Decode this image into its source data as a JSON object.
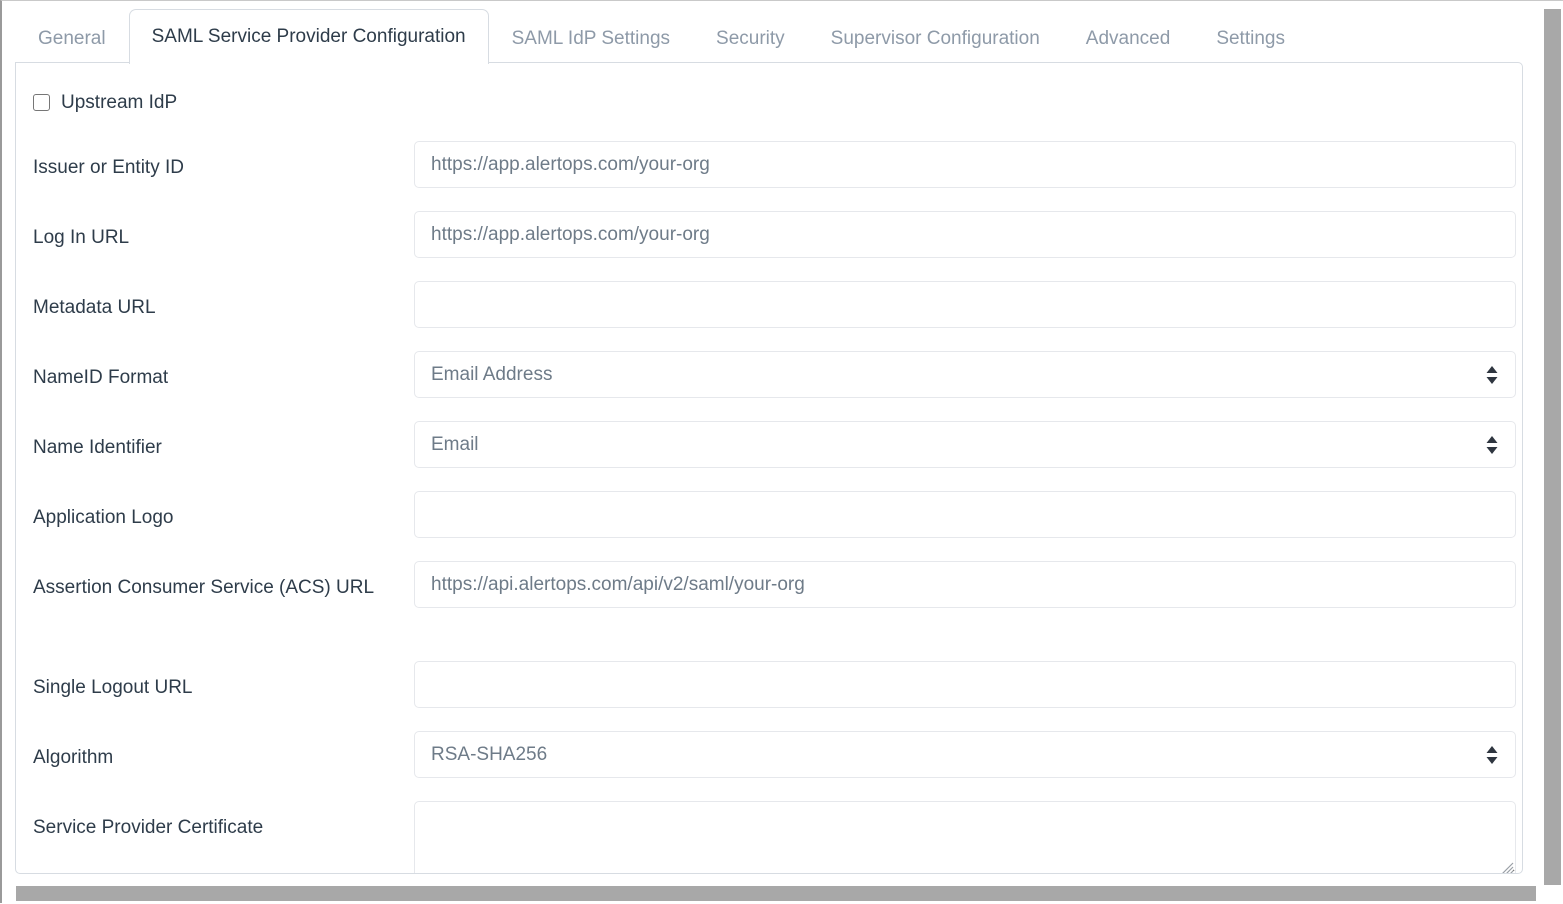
{
  "tabs": [
    {
      "label": "General",
      "active": false
    },
    {
      "label": "SAML Service Provider Configuration",
      "active": true
    },
    {
      "label": "SAML IdP Settings",
      "active": false
    },
    {
      "label": "Security",
      "active": false
    },
    {
      "label": "Supervisor Configuration",
      "active": false
    },
    {
      "label": "Advanced",
      "active": false
    },
    {
      "label": "Settings",
      "active": false
    }
  ],
  "checkbox": {
    "label": "Upstream IdP",
    "checked": false
  },
  "fields": [
    {
      "label": "Issuer or Entity ID",
      "type": "text",
      "value": "",
      "placeholder": "https://app.alertops.com/your-org"
    },
    {
      "label": "Log In URL",
      "type": "text",
      "value": "",
      "placeholder": "https://app.alertops.com/your-org"
    },
    {
      "label": "Metadata URL",
      "type": "text",
      "value": "",
      "placeholder": ""
    },
    {
      "label": "NameID Format",
      "type": "select",
      "value": "Email Address"
    },
    {
      "label": "Name Identifier",
      "type": "select",
      "value": "Email"
    },
    {
      "label": "Application Logo",
      "type": "text",
      "value": "",
      "placeholder": ""
    },
    {
      "label": "Assertion Consumer Service (ACS) URL",
      "type": "text",
      "value": "",
      "placeholder": "https://api.alertops.com/api/v2/saml/your-org"
    },
    {
      "label": "Single Logout URL",
      "type": "text",
      "value": "",
      "placeholder": ""
    },
    {
      "label": "Algorithm",
      "type": "select",
      "value": "RSA-SHA256"
    },
    {
      "label": "Service Provider Certificate",
      "type": "textarea",
      "value": "",
      "placeholder": ""
    }
  ],
  "colors": {
    "label_text": "#2e3c4a",
    "placeholder_text": "#6e7b88",
    "tab_inactive": "#8e9aa8",
    "panel_border": "#d7dce2",
    "input_border": "#e6e8ec",
    "scrollbar": "#a8a8a8"
  },
  "icons": {
    "select_arrow": "updown-chevron-icon",
    "resize": "resize-grip-icon"
  }
}
